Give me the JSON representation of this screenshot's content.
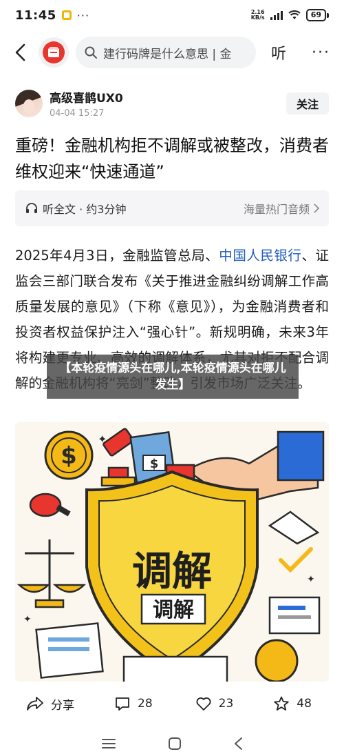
{
  "status_bar": {
    "time": "11:45",
    "net_speed_value": "2.16",
    "net_speed_unit": "KB/s",
    "network_type": "HD",
    "battery": "69"
  },
  "nav": {
    "search_placeholder": "建行码牌是什么意思 | 金",
    "listen_label": "听",
    "more_label": "···"
  },
  "author": {
    "name": "高级喜鹊UX0",
    "date": "04-04 15:27",
    "follow_label": "关注"
  },
  "article": {
    "title": "重磅！金融机构拒不调解或被整改，消费者维权迎来“快速通道”",
    "audio_label": "听全文 · 约3分钟",
    "audio_source": "海量热门音频",
    "body_part1": "2025年4月3日，金融监管总局、",
    "body_link": "中国人民银行",
    "body_part2": "、证监会三部门联合发布《关于推进金融纠纷调解工作高质量发展的意见》（下称《意见》），为金融消费者和投资者权益保护注入“强心针”。新规明确，未来3年将构建更专业、高效的调解体系，尤其对拒不配合调解的金融机构将“亮剑”整改，引发市场广泛关注。",
    "overlay_text": "【本轮疫情源头在哪儿,本轮疫情源头在哪儿发生】",
    "illustration_text_large": "调解",
    "illustration_text_small": "调解"
  },
  "actions": {
    "share_label": "分享",
    "comment_count": "28",
    "like_count": "23",
    "favorite_count": "48"
  }
}
